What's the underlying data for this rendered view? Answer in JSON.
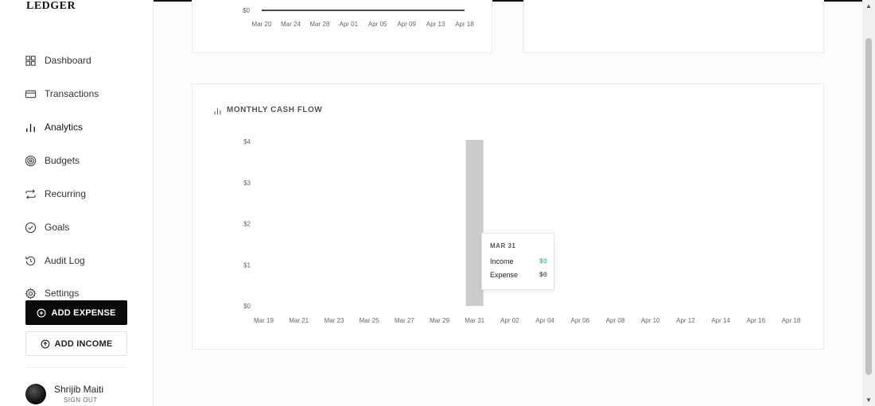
{
  "app": {
    "logo": "LEDGER"
  },
  "sidebar": {
    "items": [
      {
        "label": "Dashboard",
        "icon": "dashboard-icon"
      },
      {
        "label": "Transactions",
        "icon": "card-icon"
      },
      {
        "label": "Analytics",
        "icon": "bar-chart-icon"
      },
      {
        "label": "Budgets",
        "icon": "target-icon"
      },
      {
        "label": "Recurring",
        "icon": "repeat-icon"
      },
      {
        "label": "Goals",
        "icon": "check-circle-icon"
      },
      {
        "label": "Audit Log",
        "icon": "history-icon"
      },
      {
        "label": "Settings",
        "icon": "gear-icon"
      }
    ],
    "add_expense": "ADD EXPENSE",
    "add_income": "ADD INCOME",
    "user": {
      "name": "Shrijib Maiti",
      "sign_out": "SIGN OUT"
    }
  },
  "colors": {
    "income": "#1fae74",
    "bar": "#cccccc",
    "accent": "#0b0b0b"
  },
  "chart_data": [
    {
      "type": "line",
      "x": [
        "Mar 20",
        "Mar 24",
        "Mar 28",
        "Apr 01",
        "Apr 05",
        "Apr 09",
        "Apr 13",
        "Apr 18"
      ],
      "series": [
        {
          "values": [
            0,
            0,
            0,
            0,
            0,
            0,
            0,
            0
          ]
        }
      ],
      "y_tick_labels": [
        "$0"
      ]
    },
    {
      "type": "bar",
      "title": "MONTHLY CASH FLOW",
      "categories": [
        "Mar 19",
        "Mar 21",
        "Mar 23",
        "Mar 25",
        "Mar 27",
        "Mar 29",
        "Mar 31",
        "Apr 02",
        "Apr 04",
        "Apr 06",
        "Apr 08",
        "Apr 10",
        "Apr 12",
        "Apr 14",
        "Apr 16",
        "Apr 18"
      ],
      "y_tick_labels": [
        "$0",
        "$1",
        "$2",
        "$3",
        "$4"
      ],
      "ylim": [
        0,
        4
      ],
      "highlight": {
        "category": "Mar 31",
        "value": 4
      },
      "tooltip": {
        "date": "MAR 31",
        "income_label": "Income",
        "income_value": "$0",
        "expense_label": "Expense",
        "expense_value": "$0"
      }
    }
  ]
}
